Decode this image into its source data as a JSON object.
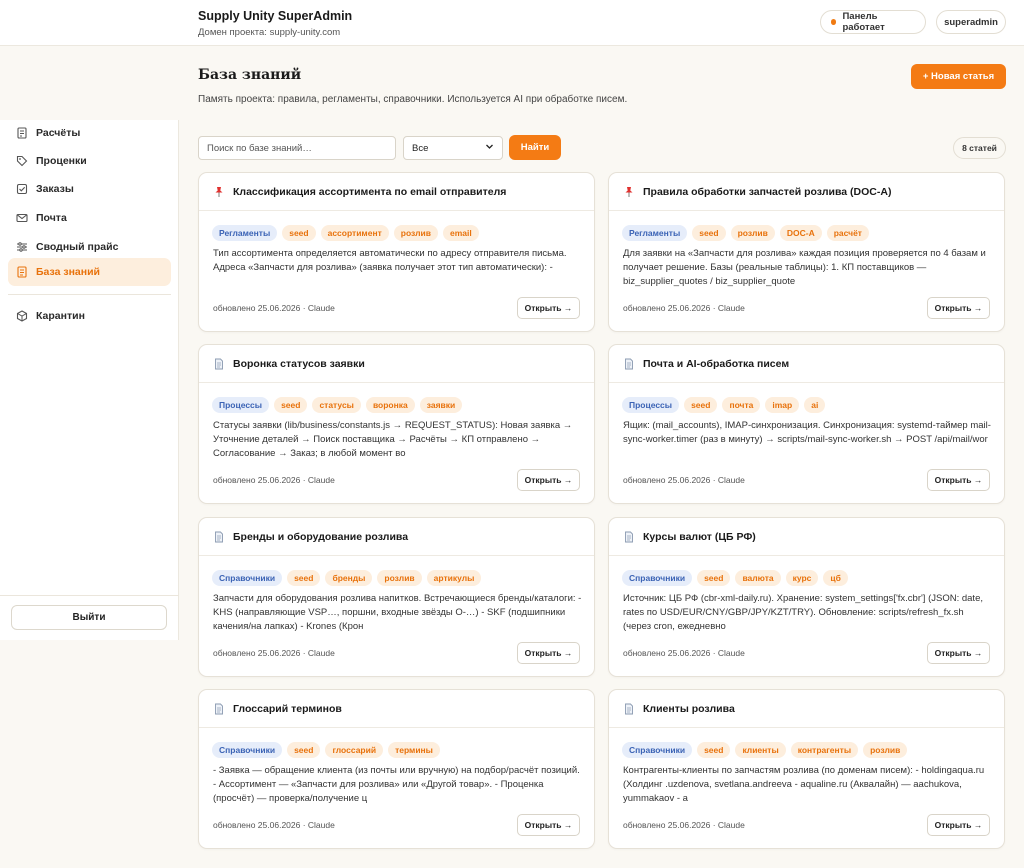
{
  "header": {
    "title": "Supply Unity SuperAdmin",
    "subtitle": "Домен проекта: supply-unity.com",
    "status": "Панель работает",
    "user": "superadmin"
  },
  "sidebar": {
    "items": [
      {
        "label": "Расчёты",
        "icon": "calculator-icon"
      },
      {
        "label": "Проценки",
        "icon": "tag-icon"
      },
      {
        "label": "Заказы",
        "icon": "checkbox-icon"
      },
      {
        "label": "Почта",
        "icon": "mail-icon"
      },
      {
        "label": "Сводный прайс",
        "icon": "sliders-icon"
      },
      {
        "label": "База знаний",
        "icon": "document-icon",
        "active": true
      },
      {
        "label": "Карантин",
        "icon": "box-icon"
      }
    ],
    "logout": "Выйти"
  },
  "main": {
    "title": "База знаний",
    "description": "Память проекта: правила, регламенты, справочники. Используется AI при обработке писем.",
    "new_button": "+ Новая статья",
    "search_placeholder": "Поиск по базе знаний…",
    "filter_value": "Все",
    "find_button": "Найти",
    "count": "8 статей"
  },
  "cards": [
    {
      "title": "Классификация ассортимента по email отправителя",
      "pinned": true,
      "tags": [
        "Регламенты",
        "seed",
        "ассортимент",
        "розлив",
        "email"
      ],
      "text": "Тип ассортимента определяется автоматически по адресу отправителя письма. Адреса «Запчасти для розлива» (заявка получает этот тип автоматически): -",
      "meta": "обновлено 25.06.2026 · Claude",
      "open": "Открыть →"
    },
    {
      "title": "Правила обработки запчастей розлива (DOC-A)",
      "pinned": true,
      "tags": [
        "Регламенты",
        "seed",
        "розлив",
        "DOC-A",
        "расчёт"
      ],
      "text": "Для заявки на «Запчасти для розлива» каждая позиция проверяется по 4 базам и получает решение. Базы (реальные таблицы): 1. КП поставщиков — biz_supplier_quotes / biz_supplier_quote",
      "meta": "обновлено 25.06.2026 · Claude",
      "open": "Открыть →"
    },
    {
      "title": "Воронка статусов заявки",
      "pinned": false,
      "tags": [
        "Процессы",
        "seed",
        "статусы",
        "воронка",
        "заявки"
      ],
      "text": "Статусы заявки (lib/business/constants.js → REQUEST_STATUS): Новая заявка → Уточнение деталей → Поиск поставщика → Расчёты → КП отправлено → Согласование → Заказ; в любой момент во",
      "meta": "обновлено 25.06.2026 · Claude",
      "open": "Открыть →"
    },
    {
      "title": "Почта и AI-обработка писем",
      "pinned": false,
      "tags": [
        "Процессы",
        "seed",
        "почта",
        "imap",
        "ai"
      ],
      "text": "Ящик: (mail_accounts), IMAP-синхронизация. Синхронизация: systemd-таймер mail-sync-worker.timer (раз в минуту) → scripts/mail-sync-worker.sh → POST /api/mail/wor",
      "meta": "обновлено 25.06.2026 · Claude",
      "open": "Открыть →"
    },
    {
      "title": "Бренды и оборудование розлива",
      "pinned": false,
      "tags": [
        "Справочники",
        "seed",
        "бренды",
        "розлив",
        "артикулы"
      ],
      "text": "Запчасти для оборудования розлива напитков. Встречающиеся бренды/каталоги: - KHS (направляющие VSP…, поршни, входные звёзды O-…) - SKF (подшипники качения/на лапках) - Krones (Крон",
      "meta": "обновлено 25.06.2026 · Claude",
      "open": "Открыть →"
    },
    {
      "title": "Курсы валют (ЦБ РФ)",
      "pinned": false,
      "tags": [
        "Справочники",
        "seed",
        "валюта",
        "курс",
        "цб"
      ],
      "text": "Источник: ЦБ РФ (cbr-xml-daily.ru). Хранение: system_settings['fx.cbr'] (JSON: date, rates по USD/EUR/CNY/GBP/JPY/KZT/TRY). Обновление: scripts/refresh_fx.sh (через cron, ежедневно",
      "meta": "обновлено 25.06.2026 · Claude",
      "open": "Открыть →"
    },
    {
      "title": "Глоссарий терминов",
      "pinned": false,
      "tags": [
        "Справочники",
        "seed",
        "глоссарий",
        "термины"
      ],
      "text": "- Заявка — обращение клиента (из почты или вручную) на подбор/расчёт позиций. - Ассортимент — «Запчасти для розлива» или «Другой товар». - Проценка (просчёт) — проверка/получение ц",
      "meta": "обновлено 25.06.2026 · Claude",
      "open": "Открыть →"
    },
    {
      "title": "Клиенты розлива",
      "pinned": false,
      "tags": [
        "Справочники",
        "seed",
        "клиенты",
        "контрагенты",
        "розлив"
      ],
      "text": "Контрагенты-клиенты по запчастям розлива (по доменам писем): - holdingaqua.ru (Холдинг .uzdenova, svetlana.andreeva - aqualine.ru (Аквалайн) — aachukova, yummakaov - a",
      "meta": "обновлено 25.06.2026 · Claude",
      "open": "Открыть →"
    }
  ]
}
